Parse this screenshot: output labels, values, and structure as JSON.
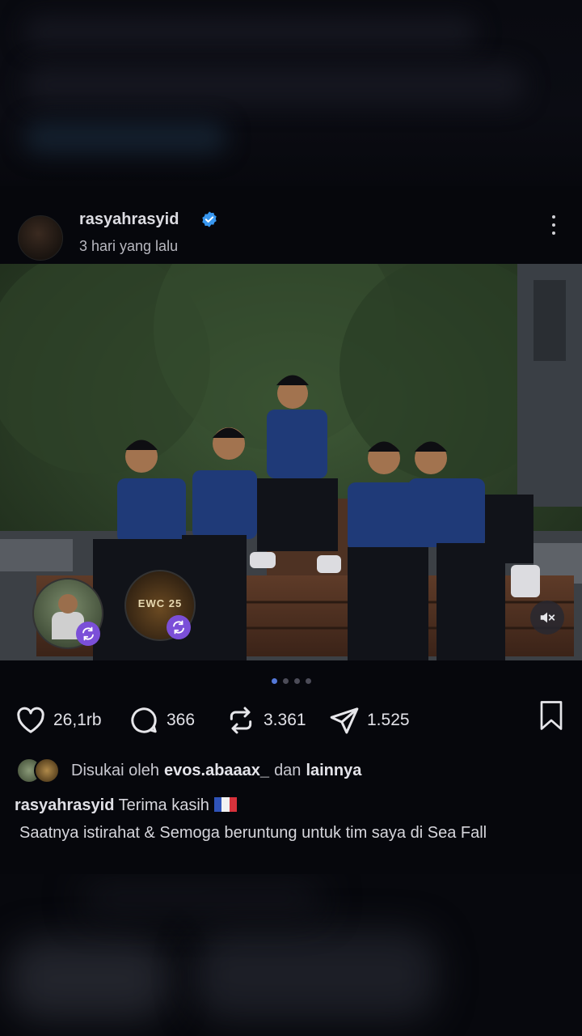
{
  "post": {
    "username": "rasyahrasyid",
    "verified": true,
    "time_ago": "3 hari yang lalu"
  },
  "actions": {
    "likes": "26,1rb",
    "comments": "366",
    "reposts": "3.361",
    "shares": "1.525"
  },
  "liked_by": {
    "prefix": "Disukai oleh",
    "user": "evos.abaaax_",
    "connector": "dan",
    "others": "lainnya"
  },
  "caption": {
    "username": "rasyahrasyid",
    "line1": "Terima kasih",
    "line2": "Saatnya istirahat & Semoga beruntung untuk tim saya di Sea Fall"
  },
  "carousel": {
    "count": 4,
    "active": 1
  },
  "story_bubbles": [
    {
      "label": ""
    },
    {
      "label": "EWC 25"
    }
  ],
  "icons": [
    "verified-icon",
    "more-icon",
    "heart-icon",
    "comment-icon",
    "repost-icon",
    "share-icon",
    "bookmark-icon",
    "mute-icon"
  ],
  "colors": {
    "background": "#06070c",
    "verified": "#3897f0",
    "dot_active": "#5478d8",
    "badge": "#7b4fd8"
  }
}
